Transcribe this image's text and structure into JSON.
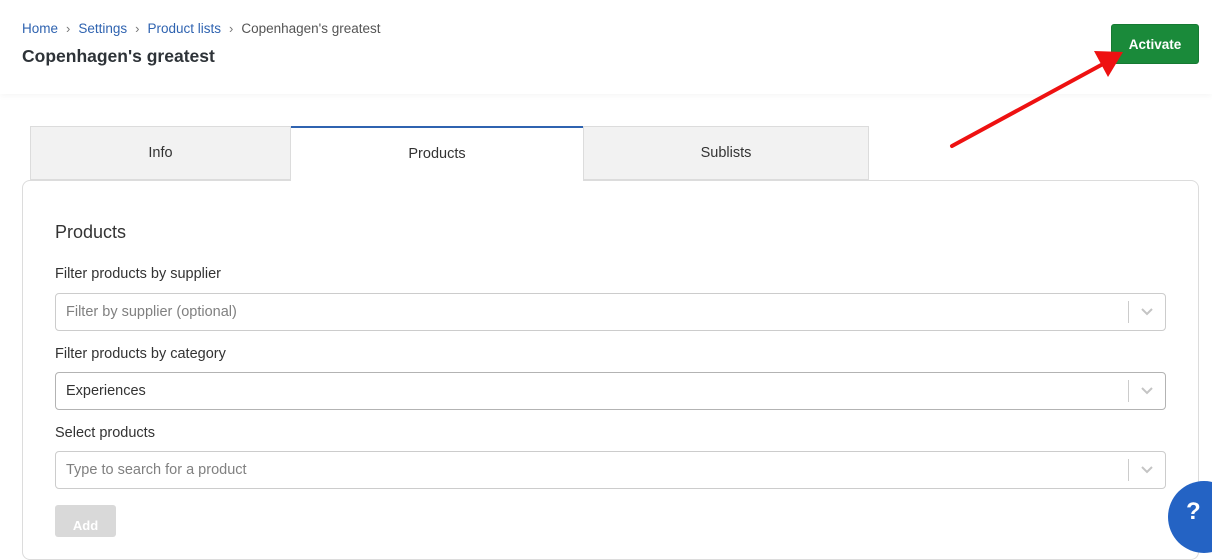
{
  "breadcrumb": {
    "items": [
      "Home",
      "Settings",
      "Product lists"
    ],
    "current": "Copenhagen's greatest",
    "separator": "›"
  },
  "page": {
    "title": "Copenhagen's greatest"
  },
  "actions": {
    "activate_label": "Activate",
    "activate_color": "#1a8a3a"
  },
  "annotation": {
    "arrow_color": "#ee1111"
  },
  "tabs": [
    {
      "label": "Info",
      "active": false
    },
    {
      "label": "Products",
      "active": true
    },
    {
      "label": "Sublists",
      "active": false
    }
  ],
  "products_section": {
    "title": "Products",
    "supplier_filter": {
      "label": "Filter products by supplier",
      "placeholder": "Filter by supplier (optional)",
      "value": ""
    },
    "category_filter": {
      "label": "Filter products by category",
      "value": "Experiences"
    },
    "product_select": {
      "label": "Select products",
      "placeholder": "Type to search for a product",
      "value": ""
    },
    "add_label": "Add"
  },
  "help": {
    "icon": "question-mark-icon",
    "label": "?"
  },
  "colors": {
    "link": "#2f63b0",
    "help": "#2463c4"
  }
}
